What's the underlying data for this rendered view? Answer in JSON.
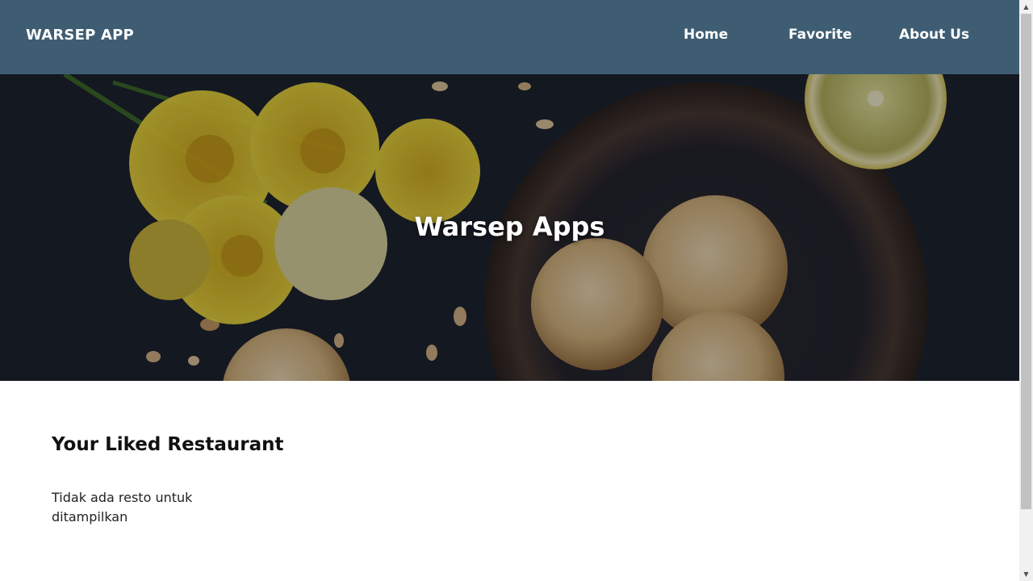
{
  "header": {
    "brand": "WARSEP APP",
    "nav": [
      {
        "label": "Home"
      },
      {
        "label": "Favorite"
      },
      {
        "label": "About Us"
      }
    ],
    "background_color": "#3e5d72"
  },
  "hero": {
    "title": "Warsep Apps",
    "image": "food-photo-cookies-daffodils-lemon"
  },
  "main": {
    "section_title": "Your Liked Restaurant",
    "empty_message": "Tidak ada resto untuk ditampilkan"
  },
  "scrollbar": {
    "up_icon": "scroll-up-arrow",
    "down_icon": "scroll-down-arrow"
  }
}
